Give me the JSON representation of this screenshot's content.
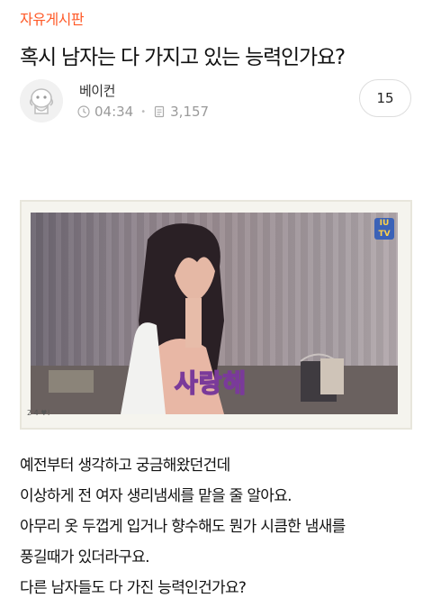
{
  "post": {
    "board": "자유게시판",
    "title": "혹시 남자는 다 가지고 있는 능력인가요?",
    "author": "베이컨",
    "time": "04:34",
    "views": "3,157",
    "comment_count": "15"
  },
  "image": {
    "caption": "사랑해",
    "watermark": "IU TV",
    "corner_note": "2 4 ♥!"
  },
  "body_lines": [
    "예전부터 생각하고 궁금해왔던건데",
    "이상하게 전 여자 생리냄세를 맡을 줄 알아요.",
    "아무리 옷 두껍게 입거나 향수해도 뭔가 시큼한 냄새를",
    "풍길때가 있더라구요.",
    "다른 남자들도 다 가진 능력인건가요?"
  ],
  "colors": {
    "board": "#ff5a28",
    "meta": "#9a9a9a"
  },
  "icons": {
    "clock": "clock-icon",
    "views": "document-icon",
    "avatar": "character-avatar-icon"
  }
}
